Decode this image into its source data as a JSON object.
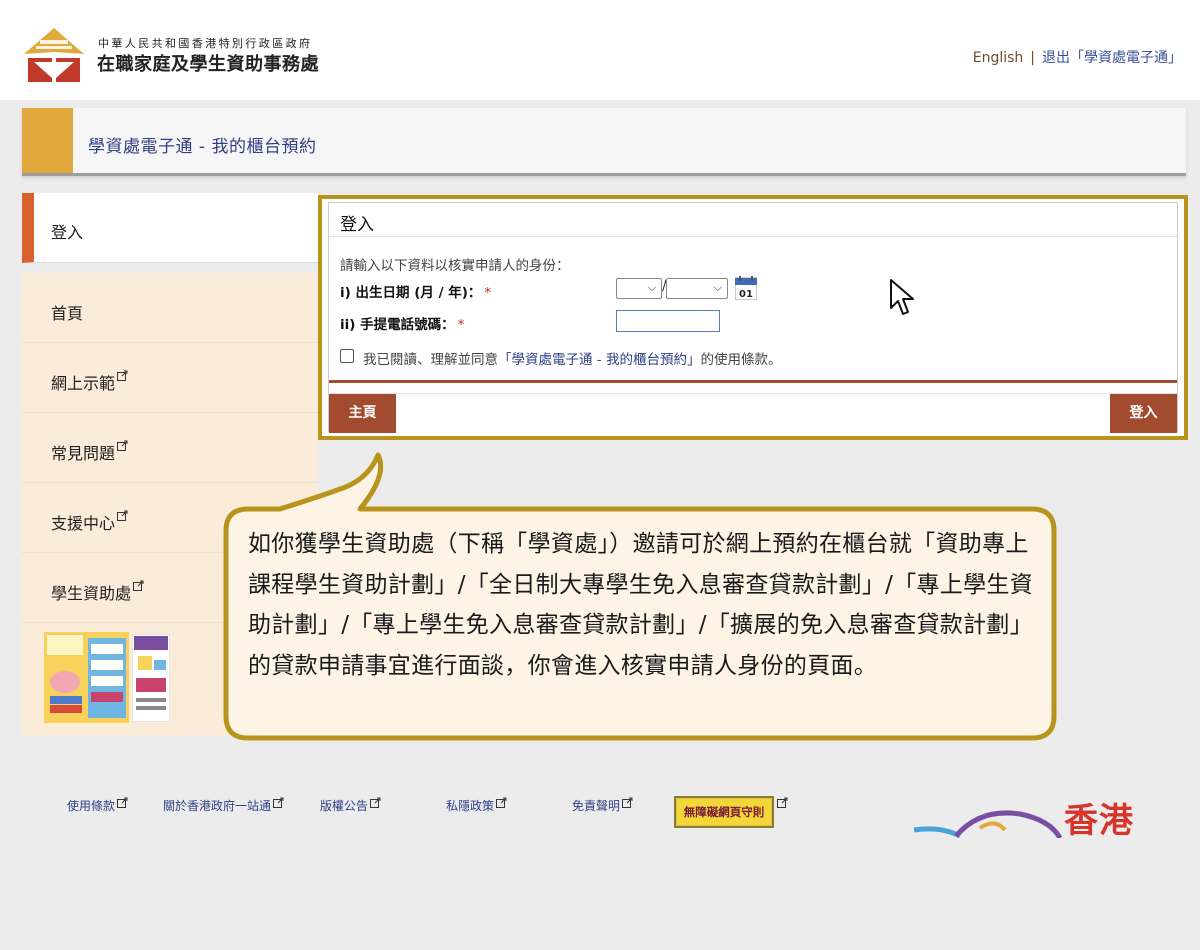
{
  "header": {
    "agency_top": "中華人民共和國香港特別行政區政府",
    "agency_name": "在職家庭及學生資助事務處",
    "lang_link": "English",
    "separator": "|",
    "logout_link": "退出「學資處電子通」"
  },
  "title_bar": {
    "title": "學資處電子通 - 我的櫃台預約"
  },
  "sidebar": {
    "items": [
      {
        "label": "登入",
        "active": true,
        "external": false
      },
      {
        "label": "首頁",
        "external": false
      },
      {
        "label": "網上示範",
        "external": true
      },
      {
        "label": "常見問題",
        "external": true
      },
      {
        "label": "支援中心",
        "external": true
      },
      {
        "label": "學生資助處",
        "external": true
      }
    ]
  },
  "login": {
    "heading": "登入",
    "instruction": "請輸入以下資料以核實申請人的身份：",
    "dob_label": "i) 出生日期 (月 / 年)：",
    "phone_label": "ii) 手提電話號碼：",
    "required_mark": "*",
    "date_separator": "/",
    "calendar_day": "01",
    "agree_prefix": "我已閱讀、理解並同意",
    "agree_link": "「學資處電子通 - 我的櫃台預約」",
    "agree_suffix": "的使用條款。",
    "home_button": "主頁",
    "submit_button": "登入"
  },
  "bubble": {
    "text": "如你獲學生資助處（下稱「學資處」）邀請可於網上預約在櫃台就「資助專上課程學生資助計劃」/「全日制大專學生免入息審查貸款計劃」/「專上學生資助計劃」/「專上學生免入息審查貸款計劃」/「擴展的免入息審查貸款計劃」的貸款申請事宜進行面談，你會進入核實申請人身份的頁面。"
  },
  "footer": {
    "links": [
      "使用條款",
      "關於香港政府一站通",
      "版權公告",
      "私隱政策",
      "免責聲明"
    ],
    "accessibility_badge": "無障礙網頁守則",
    "brand": "香港"
  },
  "colors": {
    "accent_orange": "#d9612e",
    "accent_gold": "#e1a93d",
    "panel_border": "#b8941c",
    "button_brown": "#a24b2e",
    "link_blue": "#2e3f86",
    "sidebar_bg": "#fbecd9",
    "bubble_bg": "#fdf4e6"
  }
}
